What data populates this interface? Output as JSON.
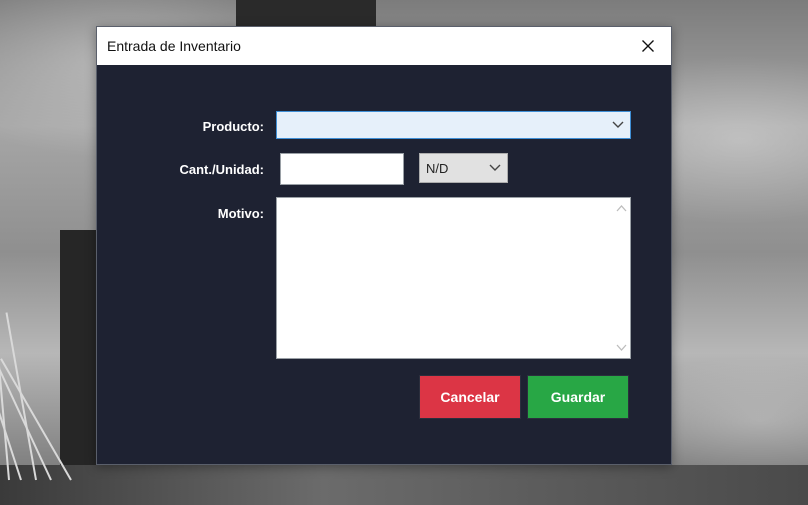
{
  "window": {
    "title": "Entrada de Inventario",
    "close_icon": "close-icon"
  },
  "form": {
    "product_label": "Producto:",
    "product_value": "",
    "quantity_label": "Cant./Unidad:",
    "quantity_value": "",
    "unit_value": "N/D",
    "reason_label": "Motivo:",
    "reason_value": ""
  },
  "buttons": {
    "cancel_label": "Cancelar",
    "save_label": "Guardar"
  },
  "colors": {
    "dialog_background": "#1e2232",
    "cancel": "#dc3545",
    "save": "#28a745",
    "focus_border": "#3f8fd6"
  }
}
